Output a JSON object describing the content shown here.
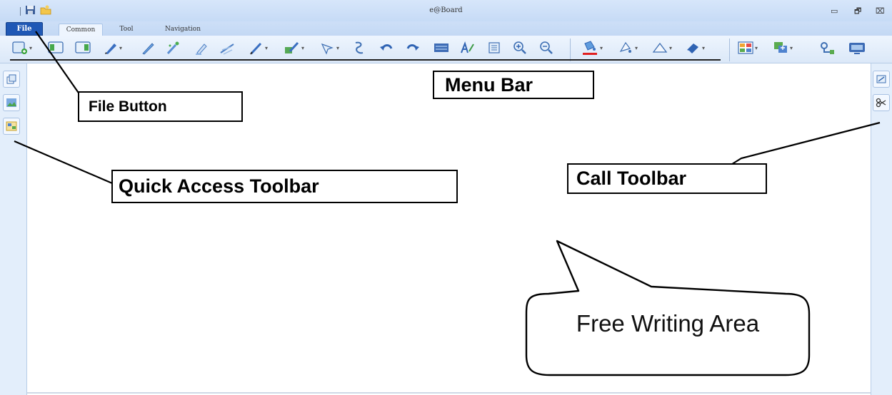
{
  "window": {
    "title": "e@Board",
    "controls": {
      "minimize": "▭",
      "restore": "🗗",
      "close": "⌧"
    }
  },
  "menu": {
    "file_label": "File",
    "tabs": [
      {
        "label": "Common",
        "active": true
      },
      {
        "label": "Tool",
        "active": false
      },
      {
        "label": "Navigation",
        "active": false
      }
    ]
  },
  "toolbar": {
    "tools": [
      "new-page-icon",
      "previous-page-icon",
      "next-page-icon",
      "pen-icon",
      "pencil-icon",
      "brush-icon",
      "highlighter-icon",
      "laser-pen-icon",
      "marker-icon",
      "fill-pen-icon",
      "select-arrow-icon",
      "gesture-icon",
      "undo-icon",
      "redo-icon",
      "screen-icon",
      "handwriting-icon",
      "fit-screen-icon",
      "zoom-in-icon",
      "zoom-out-icon",
      "fill-color-icon",
      "line-color-icon",
      "shape-icon",
      "eraser-icon",
      "layout-icon",
      "insert-icon",
      "connect-icon",
      "display-icon"
    ],
    "accent_color": "#e02020"
  },
  "quick_access": {
    "buttons": [
      "copy-page-icon",
      "image-icon",
      "slideshow-icon"
    ]
  },
  "call_toolbar": {
    "buttons": [
      "call-tools-icon",
      "scissors-icon"
    ]
  },
  "annotations": {
    "file_button": "File Button",
    "menu_bar": "Menu Bar",
    "quick_access_toolbar": "Quick Access Toolbar",
    "call_toolbar": "Call Toolbar",
    "free_writing_area": "Free Writing Area"
  },
  "colors": {
    "title_bar": "#c6dbf6",
    "file_button": "#1f58b5",
    "panel": "#e3eefb"
  }
}
